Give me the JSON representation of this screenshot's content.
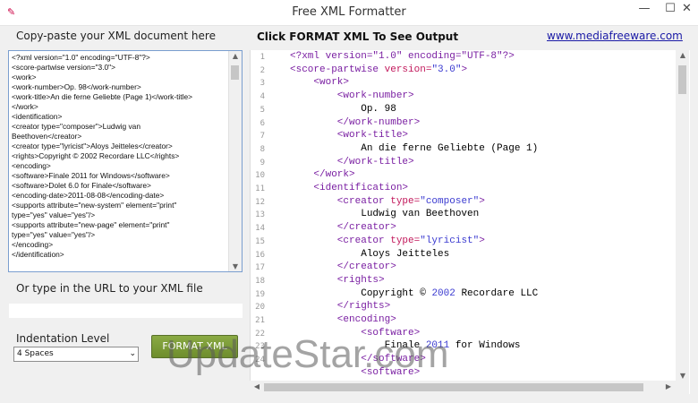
{
  "window": {
    "title": "Free XML Formatter",
    "minimize": "—",
    "maximize": "☐",
    "close": "✕"
  },
  "left": {
    "paste_label": "Copy-paste your XML document here",
    "xml_input_lines": [
      "<?xml version=\"1.0\" encoding=\"UTF-8\"?>",
      "<score-partwise version=\"3.0\">",
      "  <work>",
      "    <work-number>Op. 98</work-number>",
      "    <work-title>An die ferne Geliebte (Page 1)</work-title>",
      "  </work>",
      "  <identification>",
      "    <creator type=\"composer\">Ludwig van",
      "Beethoven</creator>",
      "    <creator type=\"lyricist\">Aloys Jeitteles</creator>",
      "    <rights>Copyright © 2002 Recordare LLC</rights>",
      "    <encoding>",
      "      <software>Finale 2011 for Windows</software>",
      "      <software>Dolet 6.0 for Finale</software>",
      "      <encoding-date>2011-08-08</encoding-date>",
      "      <supports attribute=\"new-system\" element=\"print\"",
      "type=\"yes\" value=\"yes\"/>",
      "      <supports attribute=\"new-page\" element=\"print\"",
      "type=\"yes\" value=\"yes\"/>",
      "    </encoding>",
      "  </identification>"
    ],
    "url_label": "Or type in the URL to your XML file",
    "url_value": "",
    "indent_label": "Indentation Level",
    "indent_selected": "4 Spaces",
    "format_button": "FORMAT XML"
  },
  "right": {
    "click_label": "Click FORMAT XML To See Output",
    "site_link": "www.mediafreeware.com",
    "line_numbers": [
      "1",
      "2",
      "3",
      "4",
      "5",
      "6",
      "7",
      "8",
      "9",
      "10",
      "11",
      "12",
      "13",
      "14",
      "15",
      "16",
      "17",
      "18",
      "19",
      "20",
      "21",
      "22",
      "23",
      "24"
    ],
    "code": [
      [
        {
          "c": "tag",
          "t": "<?xml version=\"1.0\" encoding=\"UTF-8\"?>"
        }
      ],
      [
        {
          "c": "tag",
          "t": "<score-partwise "
        },
        {
          "c": "attr",
          "t": "version="
        },
        {
          "c": "val",
          "t": "\"3.0\""
        },
        {
          "c": "tag",
          "t": ">"
        }
      ],
      [
        {
          "c": "tag",
          "t": "    <work>"
        }
      ],
      [
        {
          "c": "tag",
          "t": "        <work-number>"
        }
      ],
      [
        {
          "c": "txt",
          "t": "            Op. 98"
        }
      ],
      [
        {
          "c": "tag",
          "t": "        </work-number>"
        }
      ],
      [
        {
          "c": "tag",
          "t": "        <work-title>"
        }
      ],
      [
        {
          "c": "txt",
          "t": "            An die ferne Geliebte (Page 1)"
        }
      ],
      [
        {
          "c": "tag",
          "t": "        </work-title>"
        }
      ],
      [
        {
          "c": "tag",
          "t": "    </work>"
        }
      ],
      [
        {
          "c": "tag",
          "t": "    <identification>"
        }
      ],
      [
        {
          "c": "tag",
          "t": "        <creator "
        },
        {
          "c": "attr",
          "t": "type="
        },
        {
          "c": "val",
          "t": "\"composer\""
        },
        {
          "c": "tag",
          "t": ">"
        }
      ],
      [
        {
          "c": "txt",
          "t": "            Ludwig van Beethoven"
        }
      ],
      [
        {
          "c": "tag",
          "t": "        </creator>"
        }
      ],
      [
        {
          "c": "tag",
          "t": "        <creator "
        },
        {
          "c": "attr",
          "t": "type="
        },
        {
          "c": "val",
          "t": "\"lyricist\""
        },
        {
          "c": "tag",
          "t": ">"
        }
      ],
      [
        {
          "c": "txt",
          "t": "            Aloys Jeitteles"
        }
      ],
      [
        {
          "c": "tag",
          "t": "        </creator>"
        }
      ],
      [
        {
          "c": "tag",
          "t": "        <rights>"
        }
      ],
      [
        {
          "c": "txt",
          "t": "            Copyright © "
        },
        {
          "c": "val",
          "t": "2002"
        },
        {
          "c": "txt",
          "t": " Recordare LLC"
        }
      ],
      [
        {
          "c": "tag",
          "t": "        </rights>"
        }
      ],
      [
        {
          "c": "tag",
          "t": "        <encoding>"
        }
      ],
      [
        {
          "c": "tag",
          "t": "            <software>"
        }
      ],
      [
        {
          "c": "txt",
          "t": "                Finale "
        },
        {
          "c": "val",
          "t": "2011"
        },
        {
          "c": "txt",
          "t": " for Windows"
        }
      ],
      [
        {
          "c": "tag",
          "t": "            </software>"
        }
      ],
      [
        {
          "c": "tag",
          "t": "            <software>"
        }
      ]
    ]
  },
  "watermark": "UpdateStar.com"
}
